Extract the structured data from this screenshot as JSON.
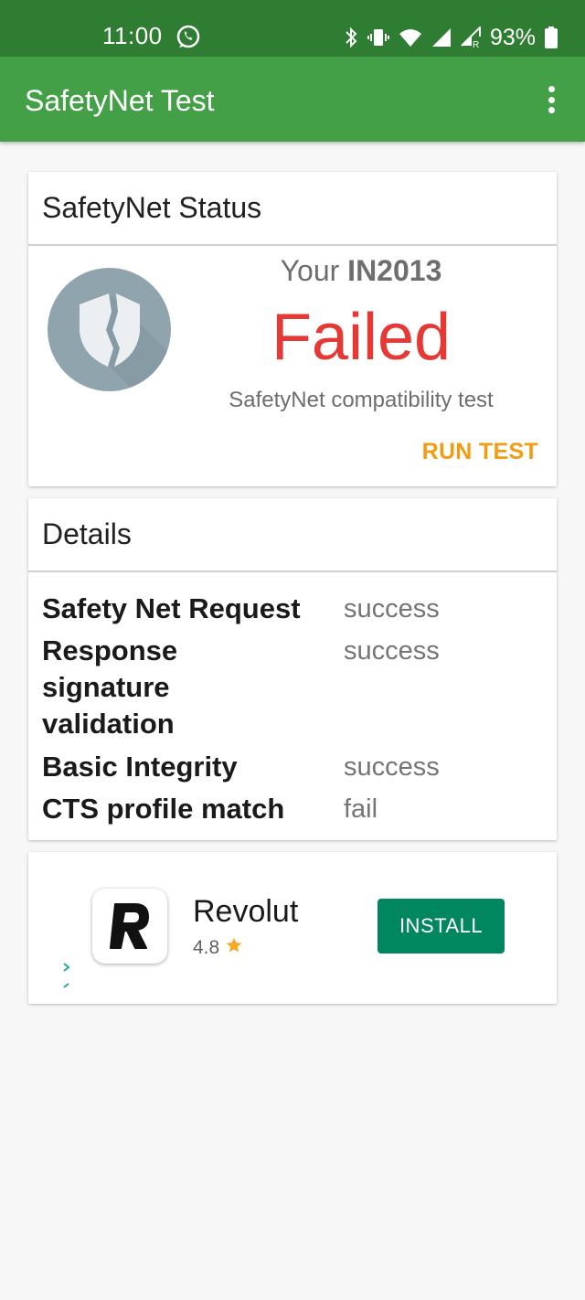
{
  "status_bar": {
    "time": "11:00",
    "battery": "93%",
    "icons": [
      "viber-icon",
      "bluetooth-icon",
      "vibrate-icon",
      "wifi-icon",
      "signal-icon",
      "signal-roaming-icon",
      "battery-icon"
    ]
  },
  "app_bar": {
    "title": "SafetyNet Test",
    "menu_icon": "more-vert-icon"
  },
  "status_card": {
    "title": "SafetyNet Status",
    "your_prefix": "Your",
    "device": "IN2013",
    "result": "Failed",
    "subtitle": "SafetyNet compatibility test",
    "action": "RUN TEST",
    "icon": "broken-shield-icon"
  },
  "details_card": {
    "title": "Details",
    "rows": [
      {
        "label": "Safety Net Request",
        "value": "success"
      },
      {
        "label": "Response signature validation",
        "value": "success"
      },
      {
        "label": "Basic Integrity",
        "value": "success"
      },
      {
        "label": "CTS profile match",
        "value": "fail"
      }
    ]
  },
  "ad": {
    "app_name": "Revolut",
    "rating": "4.8",
    "button": "INSTALL",
    "icon": "revolut-logo-icon"
  },
  "colors": {
    "status_bar": "#2f7d32",
    "app_bar": "#43a047",
    "failed": "#e53935",
    "run_test": "#f39c12",
    "install": "#01875f",
    "shield": "#90a4ae"
  }
}
